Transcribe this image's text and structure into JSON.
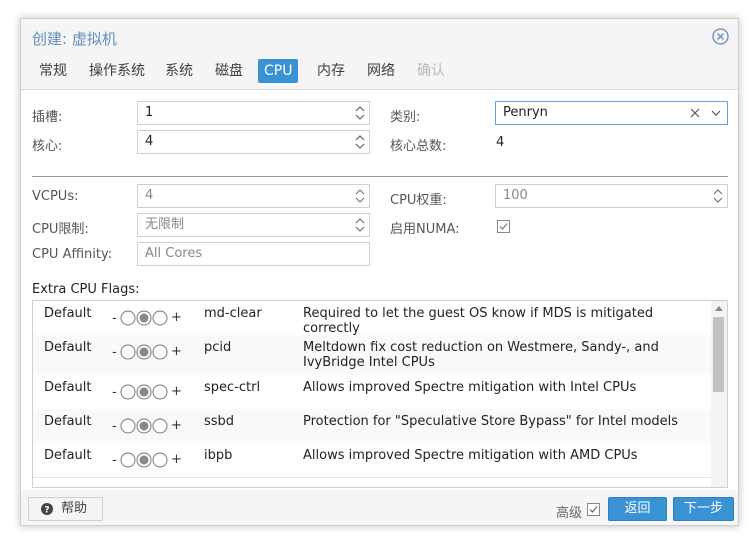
{
  "dialog": {
    "title": "创建: 虚拟机"
  },
  "tabs": [
    {
      "label": "常规"
    },
    {
      "label": "操作系统"
    },
    {
      "label": "系统"
    },
    {
      "label": "磁盘"
    },
    {
      "label": "CPU"
    },
    {
      "label": "内存"
    },
    {
      "label": "网络"
    },
    {
      "label": "确认"
    }
  ],
  "form": {
    "sockets": {
      "label": "插槽:",
      "value": "1"
    },
    "cores": {
      "label": "核心:",
      "value": "4"
    },
    "type": {
      "label": "类别:",
      "value": "Penryn"
    },
    "total_cores": {
      "label": "核心总数:",
      "value": "4"
    },
    "vcpus": {
      "label": "VCPUs:",
      "value": "4"
    },
    "cpu_weight": {
      "label": "CPU权重:",
      "placeholder": "100"
    },
    "cpu_limit": {
      "label": "CPU限制:",
      "placeholder": "无限制"
    },
    "numa": {
      "label": "启用NUMA:"
    },
    "affinity": {
      "label": "CPU Affinity:",
      "placeholder": "All Cores"
    },
    "flags_label": "Extra CPU Flags:"
  },
  "cpu_flags": [
    {
      "state": "Default",
      "minus": "-",
      "plus": "+",
      "name": "md-clear",
      "description": "Required to let the guest OS know if MDS is mitigated correctly"
    },
    {
      "state": "Default",
      "minus": "-",
      "plus": "+",
      "name": "pcid",
      "description": "Meltdown fix cost reduction on Westmere, Sandy-, and IvyBridge Intel CPUs"
    },
    {
      "state": "Default",
      "minus": "-",
      "plus": "+",
      "name": "spec-ctrl",
      "description": "Allows improved Spectre mitigation with Intel CPUs"
    },
    {
      "state": "Default",
      "minus": "-",
      "plus": "+",
      "name": "ssbd",
      "description": "Protection for \"Speculative Store Bypass\" for Intel models"
    },
    {
      "state": "Default",
      "minus": "-",
      "plus": "+",
      "name": "ibpb",
      "description": "Allows improved Spectre mitigation with AMD CPUs"
    }
  ],
  "footer": {
    "help_label": "帮助",
    "advanced_label": "高级",
    "back_label": "返回",
    "next_label": "下一步"
  },
  "colors": {
    "accent": "#3892d4",
    "title": "#5f8dbf"
  },
  "icons": [
    "close-icon",
    "help-icon",
    "spinner-icon",
    "clear-icon",
    "chevron-down-icon",
    "checkbox-icon"
  ]
}
